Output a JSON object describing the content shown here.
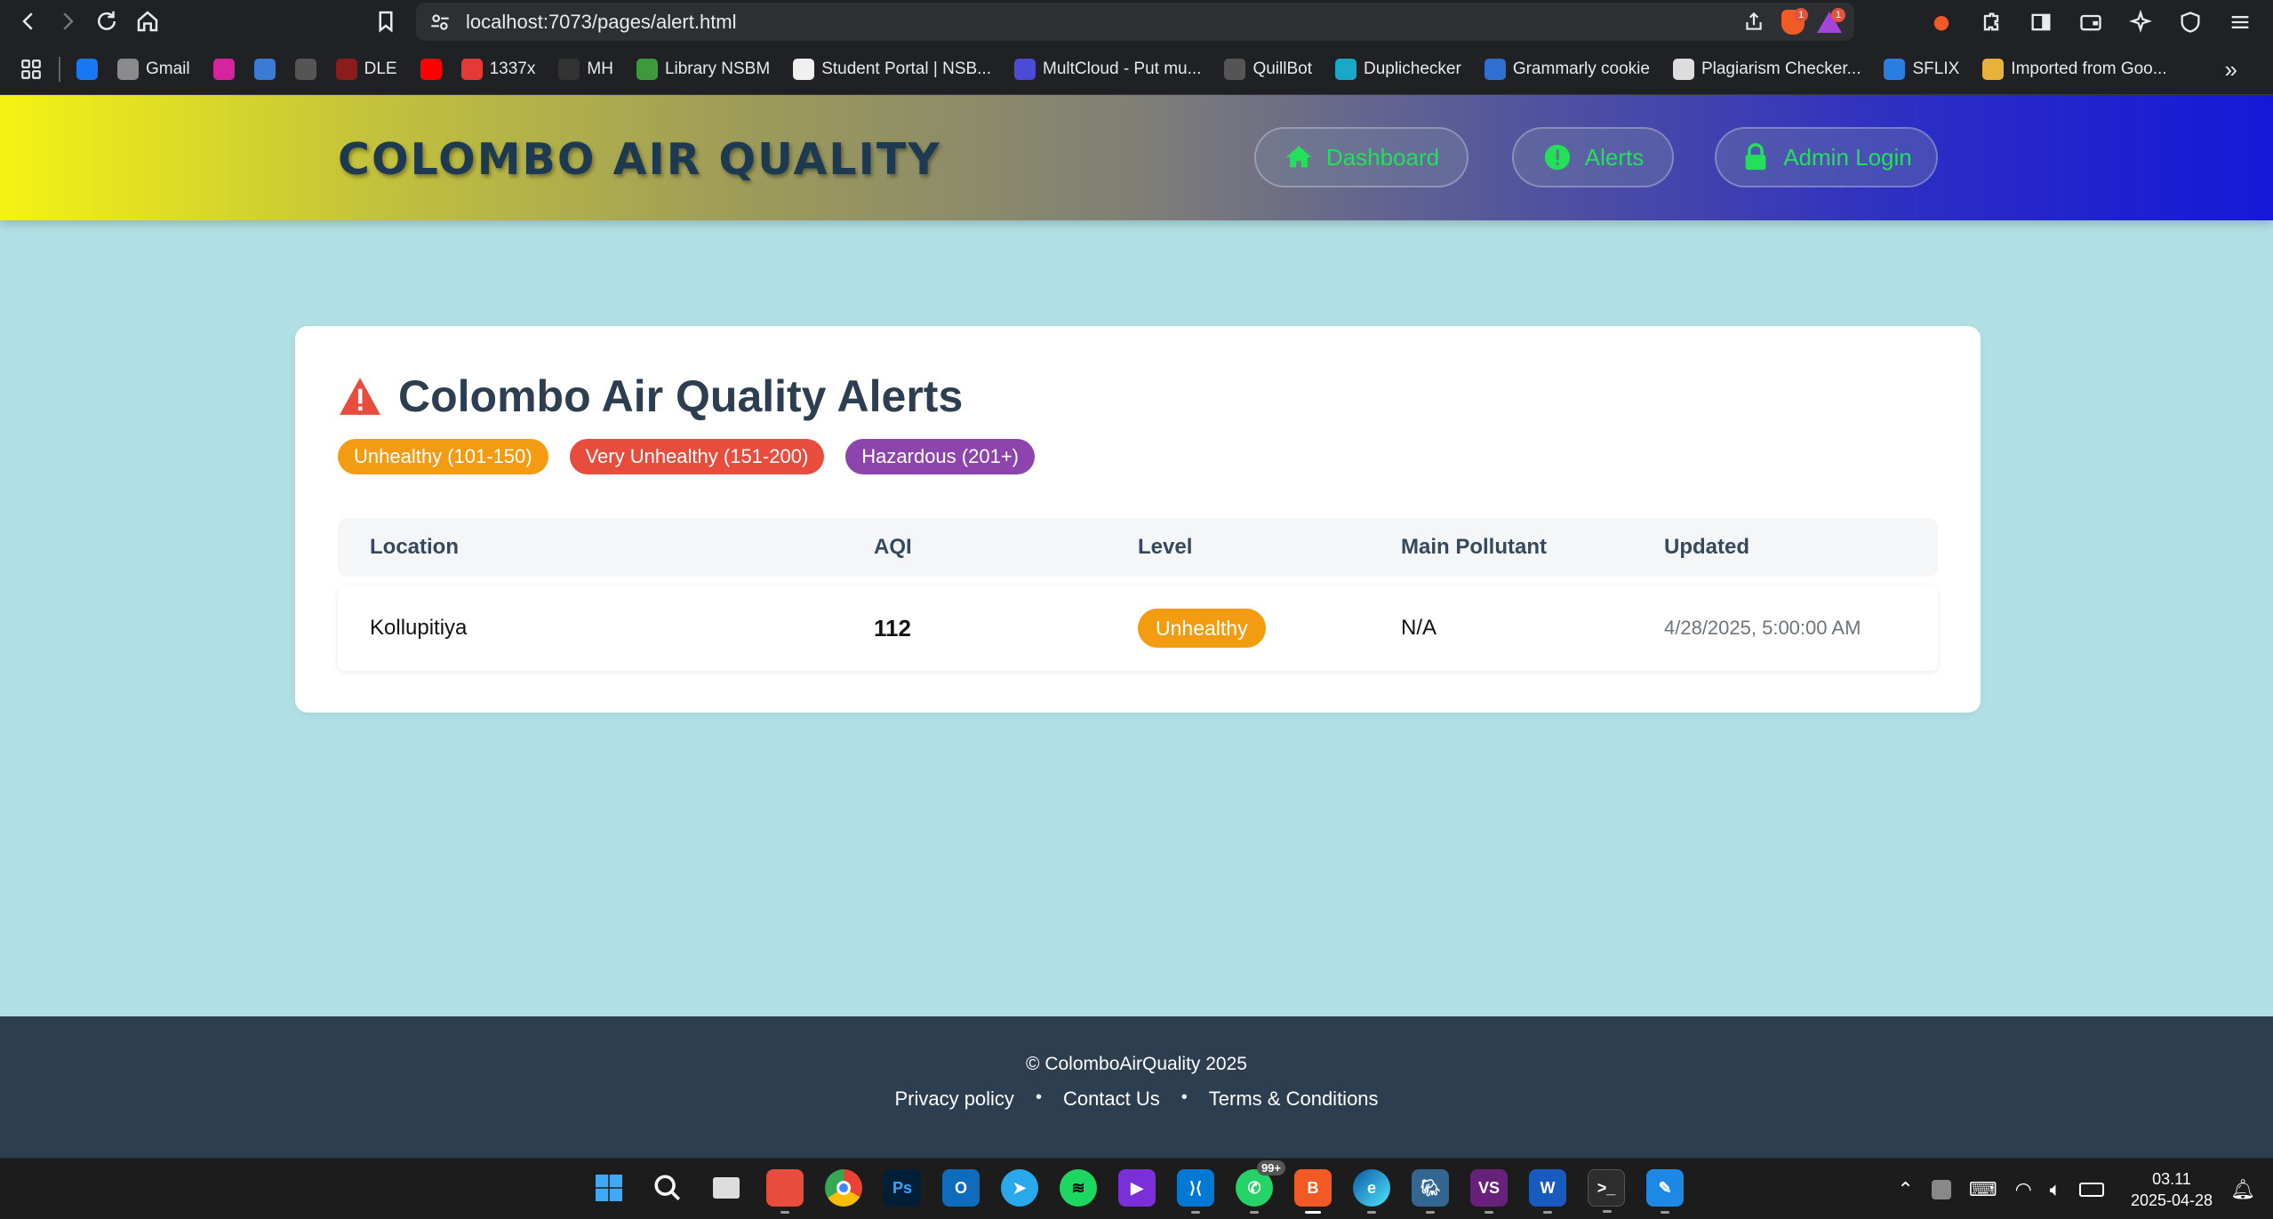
{
  "browser": {
    "url": "localhost:7073/pages/alert.html",
    "bookmarks": [
      {
        "label": "",
        "icon": "facebook",
        "color": "#1877f2"
      },
      {
        "label": "Gmail",
        "icon": "globe",
        "color": "#8a8a8a"
      },
      {
        "label": "",
        "icon": "instagram",
        "color": "#d6249f"
      },
      {
        "label": "",
        "icon": "doc",
        "color": "#3a7bd5"
      },
      {
        "label": "",
        "icon": "chatgpt",
        "color": "#555"
      },
      {
        "label": "DLE",
        "icon": "shield",
        "color": "#8c1b1b"
      },
      {
        "label": "",
        "icon": "youtube",
        "color": "#ff0000"
      },
      {
        "label": "1337x",
        "icon": "x",
        "color": "#e53935"
      },
      {
        "label": "MH",
        "icon": "mh",
        "color": "#333"
      },
      {
        "label": "Library NSBM",
        "icon": "library",
        "color": "#3c9a3c"
      },
      {
        "label": "Student Portal | NSB...",
        "icon": "portal",
        "color": "#f0f0f0"
      },
      {
        "label": "MultCloud - Put mu...",
        "icon": "cloud",
        "color": "#4b4bd6"
      },
      {
        "label": "QuillBot",
        "icon": "quill",
        "color": "#555"
      },
      {
        "label": "Duplichecker",
        "icon": "dc",
        "color": "#1ba8c8"
      },
      {
        "label": "Grammarly cookie",
        "icon": "g",
        "color": "#2f6fd0"
      },
      {
        "label": "Plagiarism Checker...",
        "icon": "pc",
        "color": "#ddd"
      },
      {
        "label": "SFLIX",
        "icon": "s",
        "color": "#2a7de1"
      },
      {
        "label": "Imported from Goo...",
        "icon": "folder",
        "color": "#e8b23a"
      }
    ]
  },
  "header": {
    "brand": "COLOMBO AIR QUALITY",
    "nav": [
      {
        "label": "Dashboard",
        "icon": "home-icon"
      },
      {
        "label": "Alerts",
        "icon": "alert-icon"
      },
      {
        "label": "Admin Login",
        "icon": "lock-icon"
      }
    ]
  },
  "alerts": {
    "title": "Colombo Air Quality Alerts",
    "legend": [
      {
        "label": "Unhealthy (101-150)",
        "color": "#f39c12"
      },
      {
        "label": "Very Unhealthy (151-200)",
        "color": "#e74c3c"
      },
      {
        "label": "Hazardous (201+)",
        "color": "#8e44ad"
      }
    ],
    "columns": [
      "Location",
      "AQI",
      "Level",
      "Main Pollutant",
      "Updated"
    ],
    "rows": [
      {
        "location": "Kollupitiya",
        "aqi": "112",
        "level": "Unhealthy",
        "pollutant": "N/A",
        "updated": "4/28/2025, 5:00:00 AM"
      }
    ]
  },
  "footer": {
    "copyright": "© ColomboAirQuality 2025",
    "links": [
      "Privacy policy",
      "Contact Us",
      "Terms & Conditions"
    ]
  },
  "taskbar": {
    "notification_count": "99+",
    "time": "03.11",
    "date": "2025-04-28"
  }
}
